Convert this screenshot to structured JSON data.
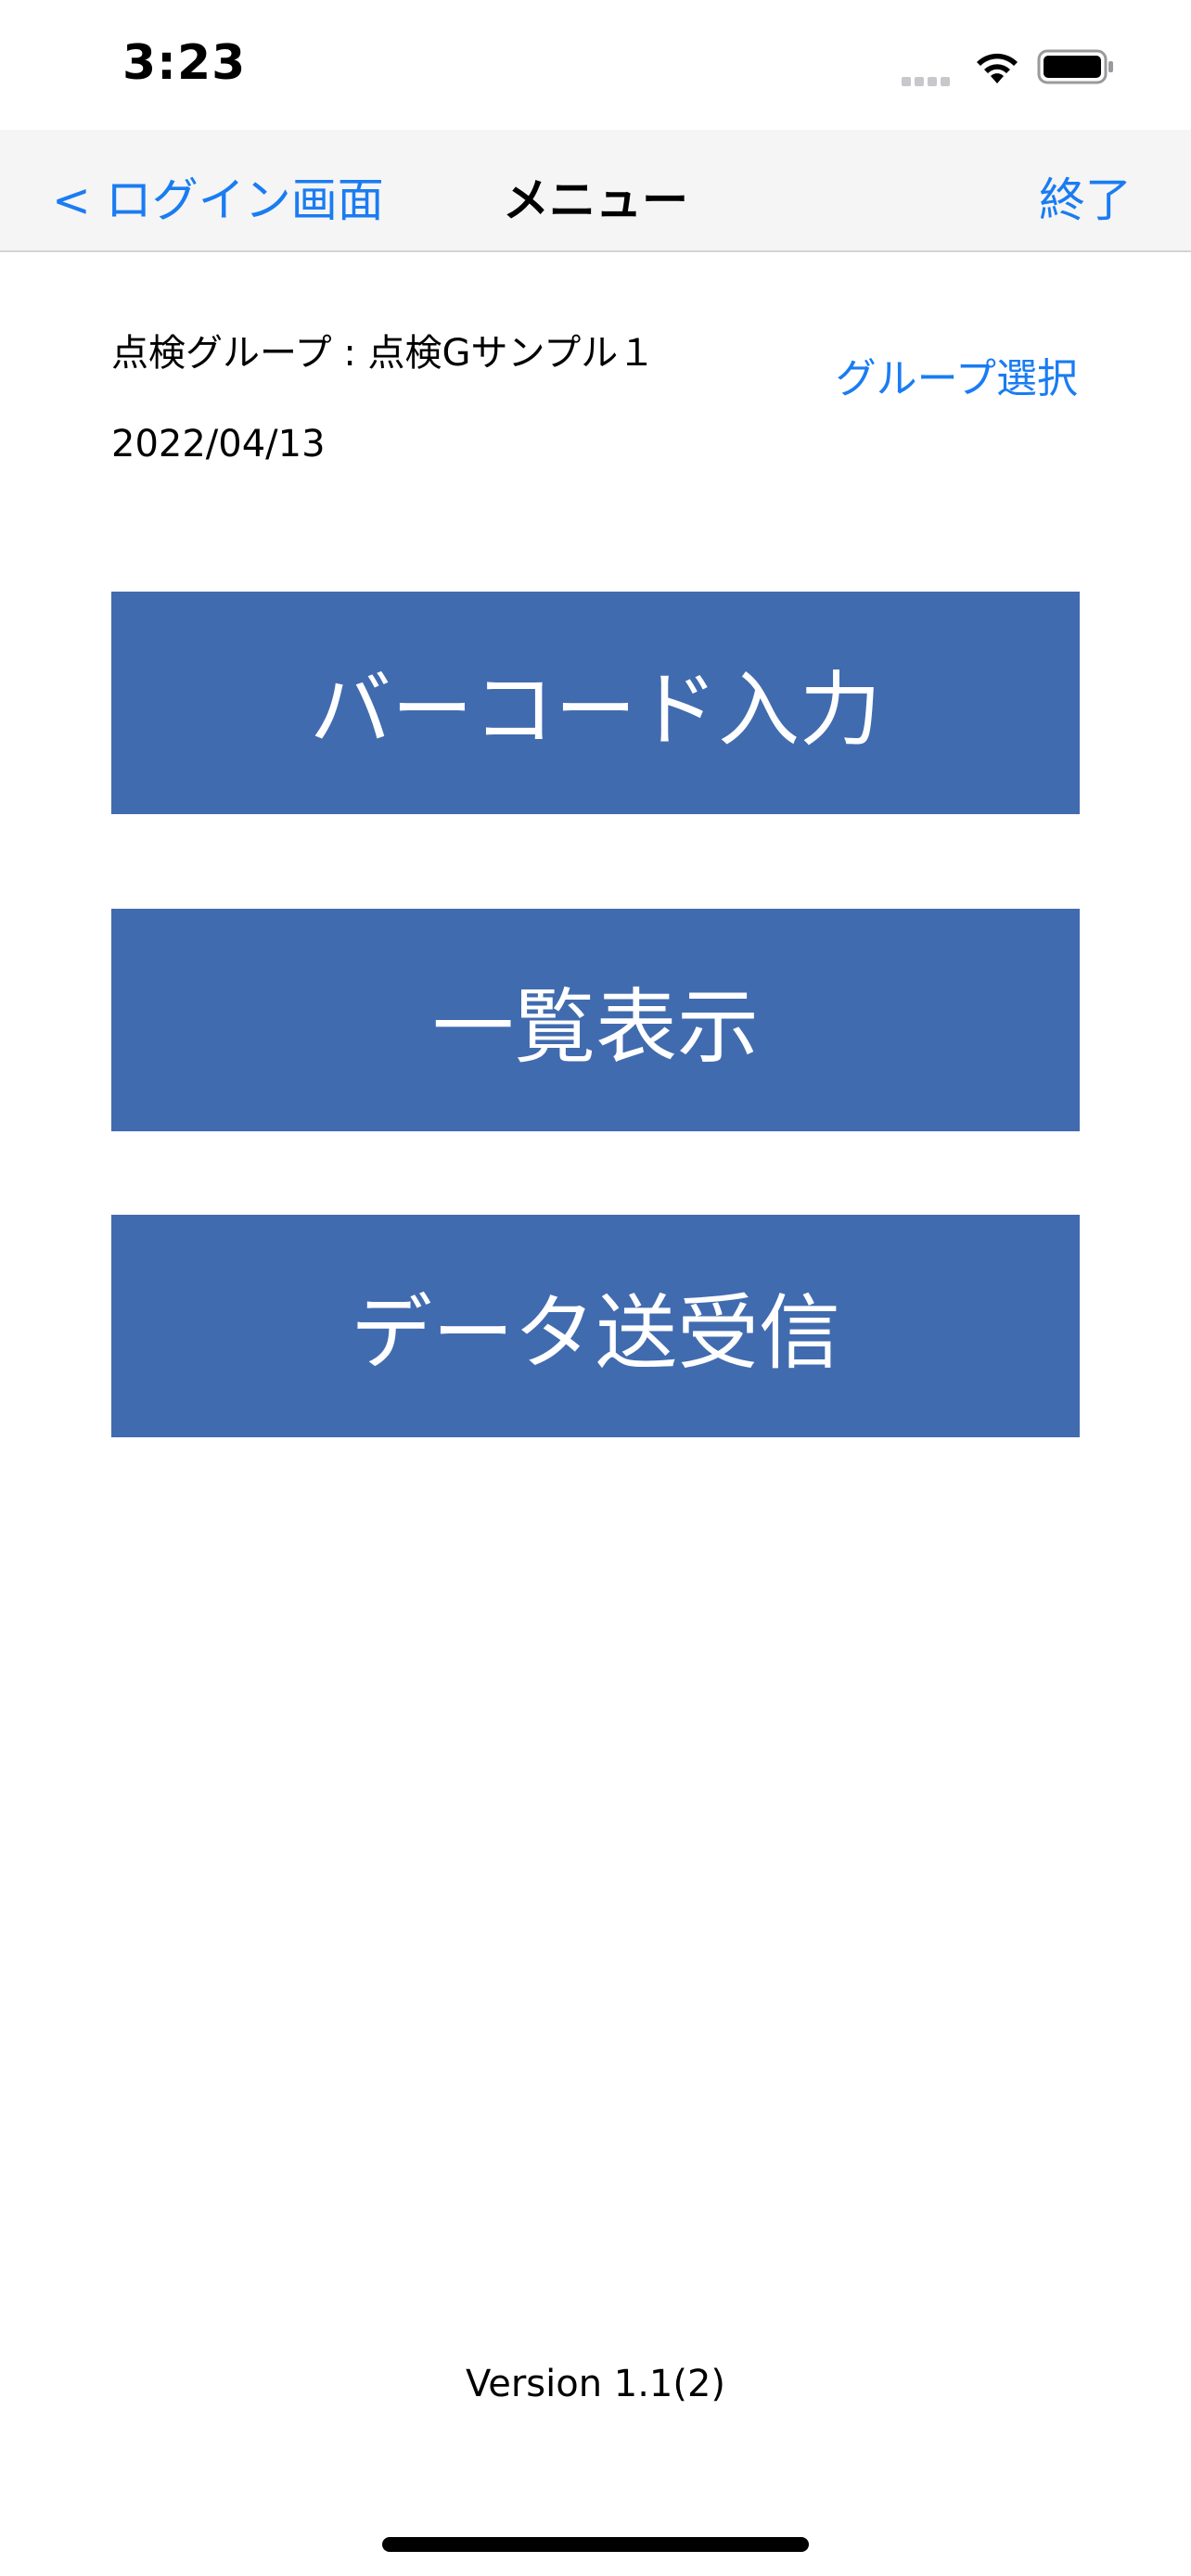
{
  "status_bar": {
    "time": "3:23"
  },
  "nav": {
    "back_label": "< ログイン画面",
    "title": "メニュー",
    "right_label": "終了"
  },
  "info": {
    "group_label": "点検グループ : 点検Gサンプル１",
    "group_select_label": "グループ選択",
    "date": "2022/04/13"
  },
  "menu": {
    "barcode_label": "バーコード入力",
    "list_label": "一覧表示",
    "sync_label": "データ送受信"
  },
  "footer": {
    "version": "Version 1.1(2)"
  },
  "colors": {
    "accent": "#1a7cf2",
    "button": "#416baf",
    "nav_bg": "#f5f5f5"
  }
}
